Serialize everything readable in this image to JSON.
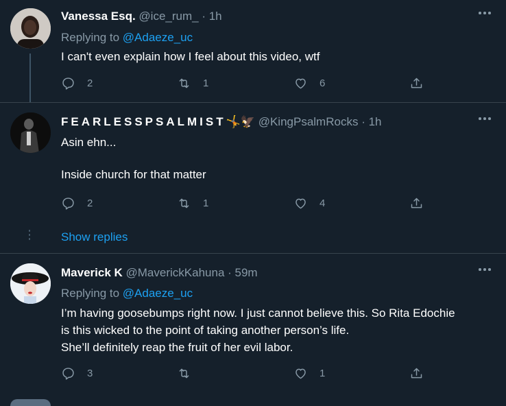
{
  "tweets": [
    {
      "name": "Vanessa Esq.",
      "handle": "@ice_rum_",
      "time": "· 1h",
      "replying_prefix": "Replying to",
      "replying_to": "@Adaeze_uc",
      "body": [
        "I can't even explain how I feel about this video, wtf"
      ],
      "replies": "2",
      "retweets": "1",
      "likes": "6"
    },
    {
      "name": "FEARLESSPSALMIST",
      "name_emoji": "🤸🦅",
      "handle": "@KingPsalmRocks",
      "time": "· 1h",
      "body": [
        "Asin ehn...",
        "Inside church for that matter"
      ],
      "replies": "2",
      "retweets": "1",
      "likes": "4",
      "show_replies": "Show replies"
    },
    {
      "name": "Maverick K",
      "handle": "@MaverickKahuna",
      "time": "· 59m",
      "replying_prefix": "Replying to",
      "replying_to": "@Adaeze_uc",
      "body": [
        "I’m having goosebumps right now. I just cannot believe this. So Rita Edochie",
        "is this wicked to the point of taking another person’s life.",
        "She’ll definitely reap the fruit of her evil labor."
      ],
      "replies": "3",
      "retweets": "",
      "likes": "1"
    }
  ],
  "colors": {
    "background": "#15202b",
    "link": "#1da1f2",
    "muted": "#8899a6",
    "text": "#ffffff",
    "divider": "#38444d"
  },
  "icons": [
    "reply-icon",
    "retweet-icon",
    "like-icon",
    "share-icon",
    "more-icon"
  ]
}
